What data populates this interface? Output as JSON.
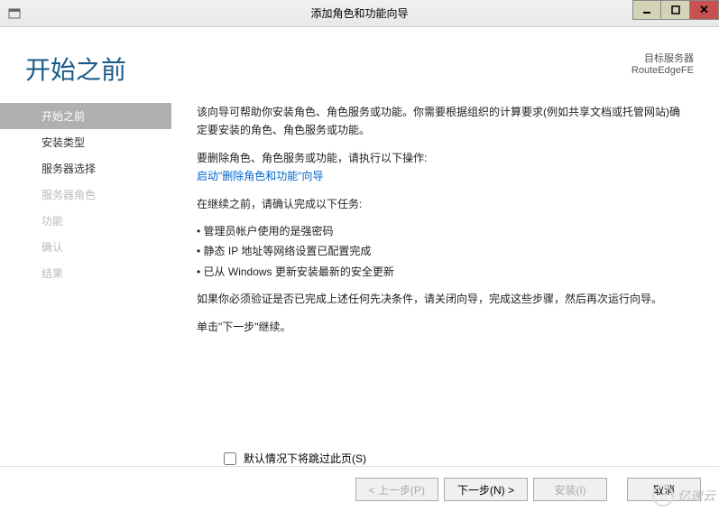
{
  "window": {
    "title": "添加角色和功能向导"
  },
  "header": {
    "page_title": "开始之前",
    "server_label": "目标服务器",
    "server_name": "RouteEdgeFE"
  },
  "sidebar": {
    "items": [
      {
        "label": "开始之前"
      },
      {
        "label": "安装类型"
      },
      {
        "label": "服务器选择"
      },
      {
        "label": "服务器角色"
      },
      {
        "label": "功能"
      },
      {
        "label": "确认"
      },
      {
        "label": "结果"
      }
    ]
  },
  "main": {
    "intro": "该向导可帮助你安装角色、角色服务或功能。你需要根据组织的计算要求(例如共享文档或托管网站)确定要安装的角色、角色服务或功能。",
    "remove_label": "要删除角色、角色服务或功能，请执行以下操作:",
    "remove_link": "启动\"删除角色和功能\"向导",
    "before_label": "在继续之前，请确认完成以下任务:",
    "checks": [
      "管理员帐户使用的是强密码",
      "静态 IP 地址等网络设置已配置完成",
      "已从 Windows 更新安装最新的安全更新"
    ],
    "verify": "如果你必须验证是否已完成上述任何先决条件，请关闭向导，完成这些步骤，然后再次运行向导。",
    "continue": "单击\"下一步\"继续。",
    "skip_label": "默认情况下将跳过此页(S)"
  },
  "footer": {
    "prev": "< 上一步(P)",
    "next": "下一步(N) >",
    "install": "安装(I)",
    "cancel": "取消"
  },
  "watermark": "亿速云"
}
